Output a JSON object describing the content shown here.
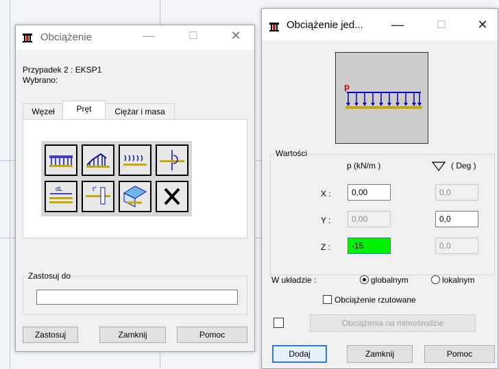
{
  "dlg1": {
    "title": "Obciążenie",
    "case_line": "Przypadek 2 : EKSP1",
    "selected_line": "Wybrano:",
    "tabs": [
      "Węzeł",
      "Pręt",
      "Ciężar i masa"
    ],
    "apply_group": "Zastosuj do",
    "apply_value": "",
    "buttons": {
      "apply": "Zastosuj",
      "close": "Zamknij",
      "help": "Pomoc"
    },
    "tools": [
      "uniform-load-icon",
      "trapezoidal-load-icon",
      "distributed-arrows-load-icon",
      "point-moment-load-icon",
      "dilatation-load-icon",
      "thermal-load-icon",
      "surface-load-icon",
      "delete-load-icon"
    ]
  },
  "dlg2": {
    "title": "Obciążenie jed...",
    "diagram_label": "p",
    "group": "Wartości",
    "col_p": "p   (kN/m )",
    "col_deg": "( Deg )",
    "rows": [
      {
        "label": "X :",
        "p": "0,00",
        "deg": "0,0"
      },
      {
        "label": "Y :",
        "p": "0,00",
        "deg": "0,0"
      },
      {
        "label": "Z :",
        "p": "-15",
        "deg": "0,0"
      }
    ],
    "system_label": "W układzie :",
    "system_options": [
      "globalnym",
      "lokalnym"
    ],
    "system_selected": "globalnym",
    "projected": "Obciążenie rzutowane",
    "eccentric": "Obciążenia na mimośrodzie",
    "buttons": {
      "add": "Dodaj",
      "close": "Zamknij",
      "help": "Pomoc"
    }
  },
  "colors": {
    "highlight": "#00f000",
    "accent": "#2f78d6",
    "load_blue": "#0000cc",
    "label_red": "#cc0000"
  }
}
